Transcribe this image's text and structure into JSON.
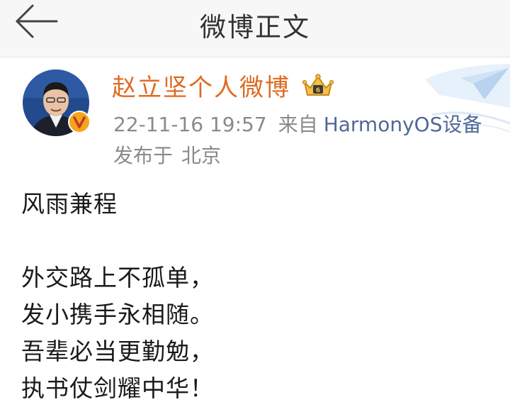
{
  "header": {
    "title": "微博正文",
    "back_icon": "back-arrow-icon"
  },
  "author": {
    "name": "赵立坚个人微博",
    "badge_icon": "crown-badge-icon",
    "verified_icon": "verified-v-icon"
  },
  "post_meta": {
    "timestamp": "22-11-16 19:57",
    "source_label": "来自",
    "source_device": "HarmonyOS设备",
    "location_label": "发布于",
    "location": "北京"
  },
  "post": {
    "lines": [
      "风雨兼程",
      "",
      "外交路上不孤单，",
      "发小携手永相随。",
      "吾辈必当更勤勉，",
      "执书仗剑耀中华！"
    ]
  },
  "colors": {
    "name": "#e06a22",
    "meta": "#8a8a8a",
    "device_link": "#506896",
    "header_bg": "#f7f7f7"
  }
}
